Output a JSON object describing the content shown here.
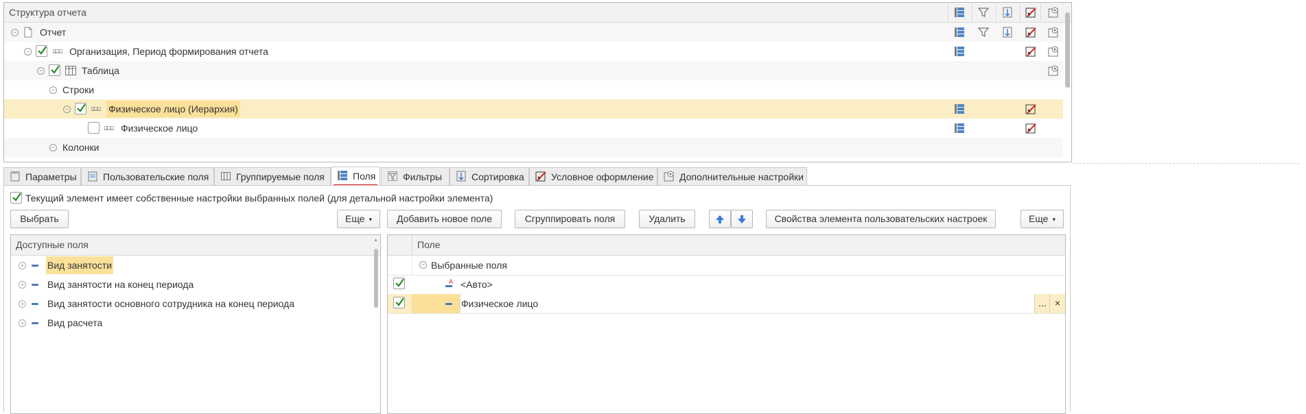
{
  "structure": {
    "title": "Структура отчета",
    "rows": [
      {
        "label": "Отчет"
      },
      {
        "label": "Организация, Период формирования отчета"
      },
      {
        "label": "Таблица"
      },
      {
        "label": "Строки"
      },
      {
        "label": "Физическое лицо (Иерархия)"
      },
      {
        "label": "Физическое лицо"
      },
      {
        "label": "Колонки"
      }
    ]
  },
  "tabs": [
    {
      "label": "Параметры",
      "icon": "parameters-icon"
    },
    {
      "label": "Пользовательские поля",
      "icon": "user-fields-icon"
    },
    {
      "label": "Группируемые поля",
      "icon": "group-fields-icon"
    },
    {
      "label": "Поля",
      "icon": "fields-icon",
      "active": true
    },
    {
      "label": "Фильтры",
      "icon": "filter-icon"
    },
    {
      "label": "Сортировка",
      "icon": "sort-icon"
    },
    {
      "label": "Условное оформление",
      "icon": "conditional-format-icon"
    },
    {
      "label": "Дополнительные настройки",
      "icon": "extra-settings-icon"
    }
  ],
  "own_settings_label": "Текущий элемент имеет собственные настройки выбранных полей (для детальной настройки элемента)",
  "buttons": {
    "choose": "Выбрать",
    "more_left": "Еще",
    "add_field": "Добавить новое поле",
    "group_fields": "Сгруппировать поля",
    "delete": "Удалить",
    "properties": "Свойства элемента пользовательских настроек",
    "more_right": "Еще"
  },
  "available_fields": {
    "header": "Доступные поля",
    "items": [
      "Вид занятости",
      "Вид занятости на конец периода",
      "Вид занятости основного сотрудника на конец периода",
      "Вид расчета"
    ]
  },
  "selected_fields": {
    "header": "Поле",
    "group_label": "Выбранные поля",
    "items": [
      {
        "label": "<Авто>",
        "checked": true
      },
      {
        "label": "Физическое лицо",
        "checked": true
      }
    ],
    "ellipsis": "...",
    "clear": "×"
  },
  "colors": {
    "selected_row": "#fbeec5",
    "highlight": "#fbe09a",
    "active_tab_underline": "#e02020",
    "check_green": "#2a8a2a",
    "accent_blue": "#3a7bd5"
  }
}
